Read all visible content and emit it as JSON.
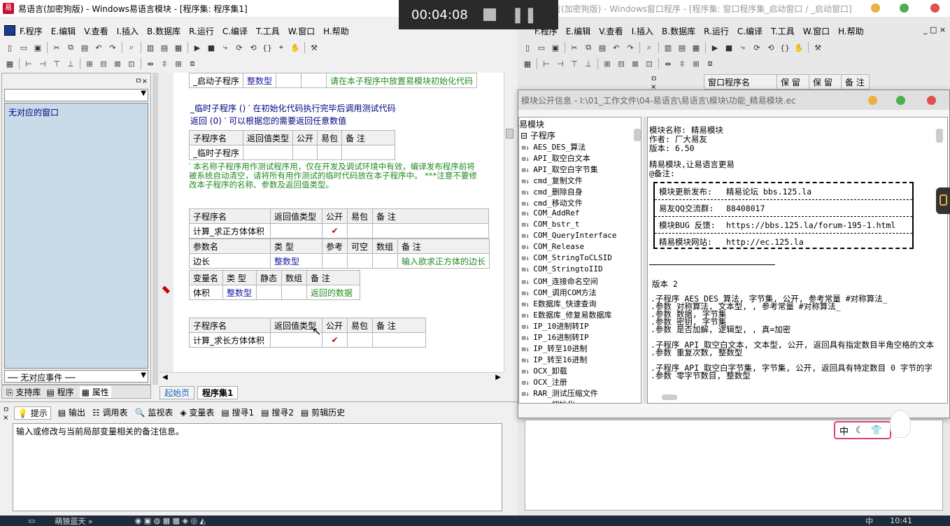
{
  "left": {
    "title": "易语言(加密狗版) - Windows易语言模块 - [程序集: 程序集1]",
    "menu": [
      "F.程序",
      "E.编辑",
      "V.查看",
      "I.插入",
      "B.数据库",
      "R.运行",
      "C.编译",
      "T.工具",
      "W.窗口",
      "H.帮助"
    ],
    "window_list_empty": "无对应的窗口",
    "event_select": "── 无对应事件 ──",
    "left_tabs": [
      "支持库",
      "程序",
      "属性"
    ],
    "start_table": {
      "name": "_启动子程序",
      "type": "整数型",
      "note": "请在本子程序中放置易模块初始化代码"
    },
    "temp_line1": "_临时子程序 ()  ′ 在初始化代码执行完毕后调用测试代码",
    "temp_line2": "返回 (0)  ′ 可以根据您的需要返回任意数值",
    "sub_headers": [
      "子程序名",
      "返回值类型",
      "公开",
      "易包",
      "备 注"
    ],
    "temp_name": "_临时子程序",
    "comment1": "′ 本名称子程序用作测试程序用，仅在开发及调试环境中有效，编译发布程序前将",
    "comment2": "被系统自动清空，请将所有用作测试的临时代码放在本子程序中。 ***注意不要修",
    "comment3": "改本子程序的名称、参数及返回值类型。",
    "calc_cube": "计算_求正方体体积",
    "check": "✔",
    "param_headers": [
      "参数名",
      "类 型",
      "参考",
      "可空",
      "数组",
      "备 注"
    ],
    "param": {
      "name": "边长",
      "type": "整数型",
      "note": "输入欲求正方体的边长"
    },
    "var_headers": [
      "变量名",
      "类 型",
      "静态",
      "数组",
      "备 注"
    ],
    "var": {
      "name": "体积",
      "type": "整数型",
      "note": "返回的数据"
    },
    "calc_box": "计算_求长方体体积",
    "editor_tabs": [
      "起始页",
      "程序集1"
    ],
    "bottom_tabs": [
      "提示",
      "输出",
      "调用表",
      "监视表",
      "变量表",
      "搜寻1",
      "搜寻2",
      "剪辑历史"
    ],
    "hint": "输入或修改与当前局部变量相关的备注信息。"
  },
  "right": {
    "title": "易语言(加密狗版) - Windows窗口程序 - [程序集: 窗口程序集_启动窗口 / _启动窗口]",
    "menu": [
      "F.程序",
      "E.编辑",
      "V.查看",
      "I.插入",
      "B.数据库",
      "R.运行",
      "C.编译",
      "T.工具",
      "W.窗口",
      "H.帮助"
    ],
    "behind_headers": [
      "窗口程序名",
      "保 留",
      "保 留",
      "备 注"
    ],
    "dialog_title": "模块公开信息 - I:\\01_工作文件\\04-易语言\\易语言\\模块\\功能_精易模块.ec",
    "tree_root": "易模块",
    "tree_sub": "子程序",
    "tree_items": [
      "AES_DES_算法",
      "API_取空白文本",
      "API_取空白字节集",
      "cmd_复制文件",
      "cmd_删除自身",
      "cmd_移动文件",
      "COM_AddRef",
      "COM_bstr_t",
      "COM_QueryInterface",
      "COM_Release",
      "COM_StringToCLSID",
      "COM_StringtoIID",
      "COM_连接命名空间",
      "COM_调用COM方法",
      "E数据库_快速查询",
      "E数据库_修复易数据库",
      "IP_10进制转IP",
      "IP_16进制转IP",
      "IP_转至10进制",
      "IP_转至16进制",
      "OCX_卸载",
      "OCX_注册",
      "RAR_测试压缩文件",
      "rar_初始化"
    ],
    "info_name": "模块名称: 精易模块",
    "info_author": "作者: 厂大易友",
    "info_version": "版本: 6.50",
    "info_slogan": "精易模块,让易语言更易",
    "info_remark": "@备注:",
    "box_rows": [
      {
        "k": "模块更新发布:",
        "v": "精易论坛  bbs.125.la"
      },
      {
        "k": "易友QQ交流群:",
        "v": "88408017"
      },
      {
        "k": "模块BUG 反馈:",
        "v": "https://bbs.125.la/forum-195-1.html"
      },
      {
        "k": "精易模块网站:",
        "v": "http://ec.125.la"
      }
    ],
    "ver2": "版本 2",
    "code_lines": [
      ".子程序 AES_DES_算法, 字节集, 公开, 参考常量  #对称算法_",
      ".参数 对称算法, 文本型, , 参考常量  #对称算法_",
      ".参数 数据, 字节集",
      ".参数 密钥, 字节集",
      ".参数 是否加解, 逻辑型, , 真=加密",
      "",
      ".子程序 API_取空白文本, 文本型, 公开, 返回具有指定数目半角空格的文本",
      ".参数 重复次数, 整数型",
      "",
      ".子程序 API_取空白字节集, 字节集, 公开, 返回具有特定数目 0 字节的字",
      ".参数 零字节数目, 整数型"
    ]
  },
  "recorder": {
    "time": "00:04:08"
  },
  "ime": {
    "items": [
      "中",
      "☾",
      "👕"
    ]
  },
  "taskbar": {
    "items": [
      "萌狼蓝天 »"
    ],
    "clock": "10:41",
    "ime": "中"
  }
}
